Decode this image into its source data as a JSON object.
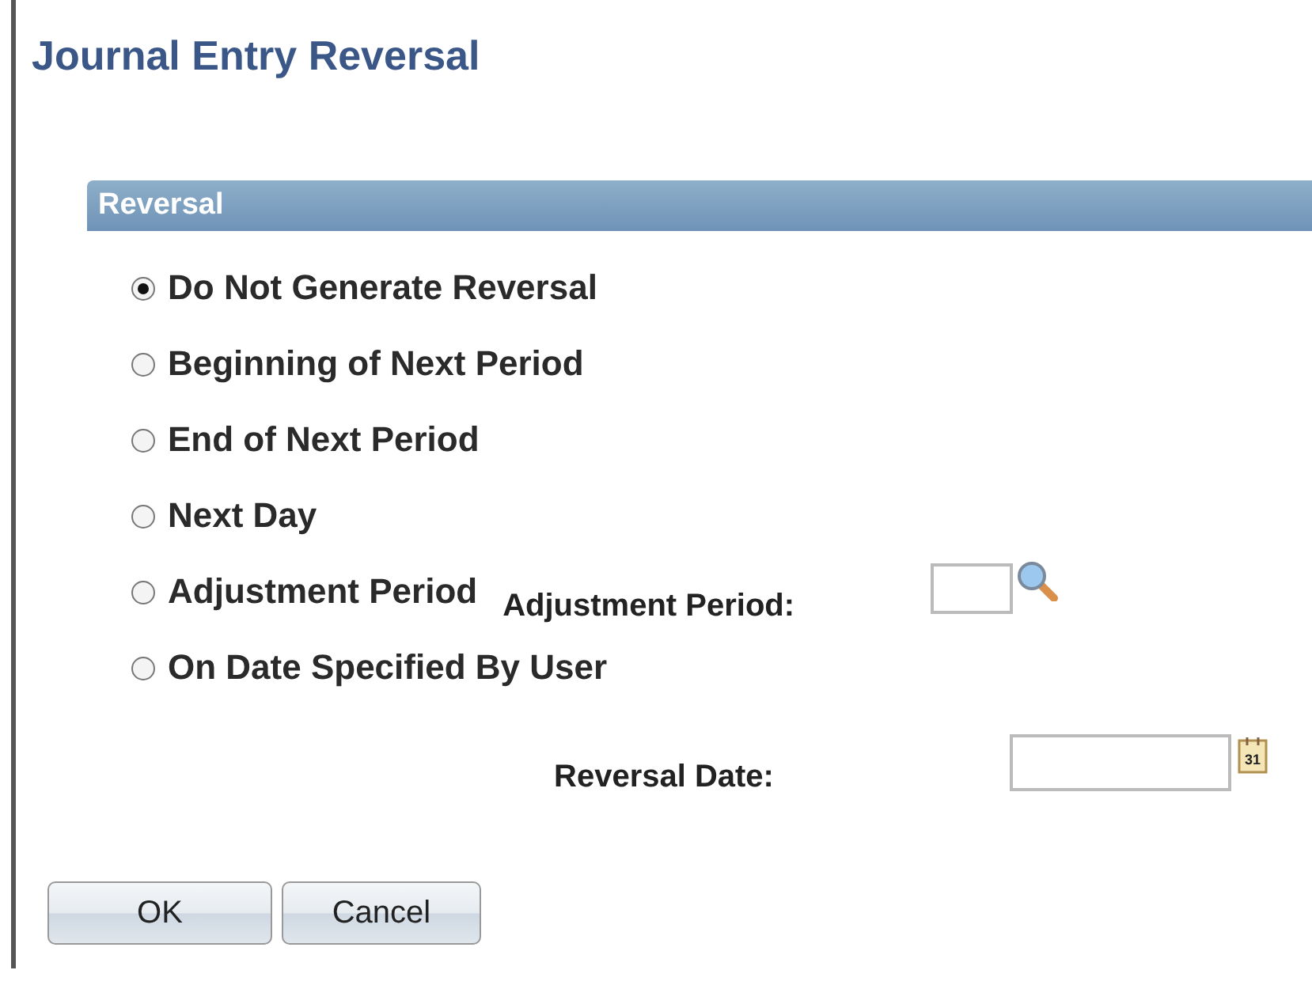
{
  "title": "Journal Entry Reversal",
  "section": {
    "title": "Reversal"
  },
  "options": [
    {
      "label": "Do Not Generate Reversal",
      "selected": true
    },
    {
      "label": "Beginning of Next Period",
      "selected": false
    },
    {
      "label": "End of Next Period",
      "selected": false
    },
    {
      "label": "Next Day",
      "selected": false
    },
    {
      "label": "Adjustment Period",
      "selected": false,
      "field": {
        "label": "Adjustment Period:"
      }
    },
    {
      "label": "On Date Specified By User",
      "selected": false
    }
  ],
  "reversal_date": {
    "label": "Reversal Date:",
    "calendar_day": "31"
  },
  "buttons": [
    "OK",
    "Cancel"
  ]
}
